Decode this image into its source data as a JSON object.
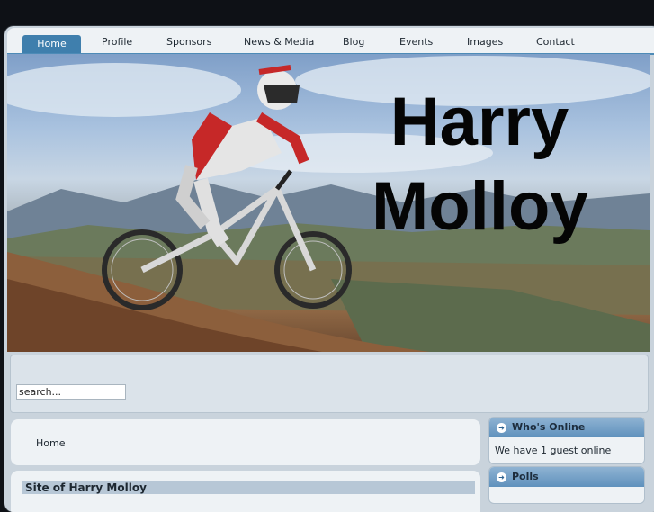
{
  "nav": {
    "items": [
      {
        "label": "Home",
        "active": true
      },
      {
        "label": "Profile",
        "active": false
      },
      {
        "label": "Sponsors",
        "active": false
      },
      {
        "label": "News & Media",
        "active": false
      },
      {
        "label": "Blog",
        "active": false
      },
      {
        "label": "Events",
        "active": false
      },
      {
        "label": "Images",
        "active": false
      },
      {
        "label": "Contact",
        "active": false
      }
    ]
  },
  "hero": {
    "name_line1": "Harry",
    "name_line2": "Molloy"
  },
  "search": {
    "placeholder": "search...",
    "value": "search..."
  },
  "breadcrumb": {
    "label": "Home"
  },
  "content": {
    "title": "Site of Harry Molloy"
  },
  "modules": {
    "whos_online": {
      "title": "Who's Online",
      "text": "We have 1 guest online"
    },
    "polls": {
      "title": "Polls"
    }
  },
  "colors": {
    "accent": "#3f7fad",
    "nav_bg": "#eef2f5",
    "frame_bg": "#c9d3dc",
    "module_head": "#5f91bd"
  }
}
